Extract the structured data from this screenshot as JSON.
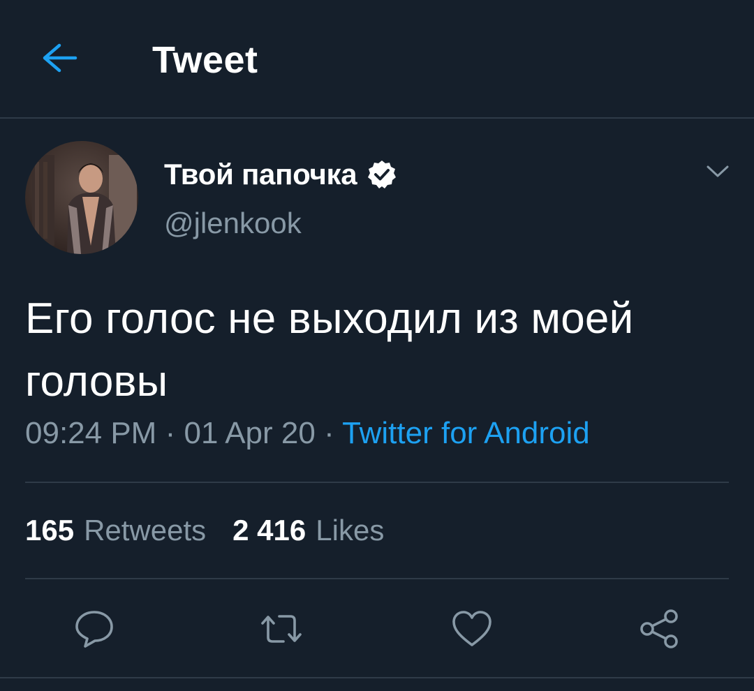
{
  "colors": {
    "background": "#151f2b",
    "accent": "#1da1f2",
    "secondary_text": "#8899a6",
    "divider": "#2f3b48"
  },
  "header": {
    "title": "Tweet",
    "back_icon": "arrow-left-icon"
  },
  "author": {
    "display_name": "Твой папочка",
    "username": "@jlenkook",
    "verified": true,
    "verified_icon": "verified-badge-icon",
    "menu_icon": "chevron-down-icon"
  },
  "tweet": {
    "text": "Его голос не выходил из моей головы",
    "time": "09:24 PM",
    "separator": "·",
    "date": "01 Apr 20",
    "source": "Twitter for Android"
  },
  "stats": {
    "retweets_count": "165",
    "retweets_label": "Retweets",
    "likes_count": "2 416",
    "likes_label": "Likes"
  },
  "actions": [
    {
      "name": "reply",
      "icon": "comment-icon"
    },
    {
      "name": "retweet",
      "icon": "retweet-icon"
    },
    {
      "name": "like",
      "icon": "heart-icon"
    },
    {
      "name": "share",
      "icon": "share-icon"
    }
  ]
}
